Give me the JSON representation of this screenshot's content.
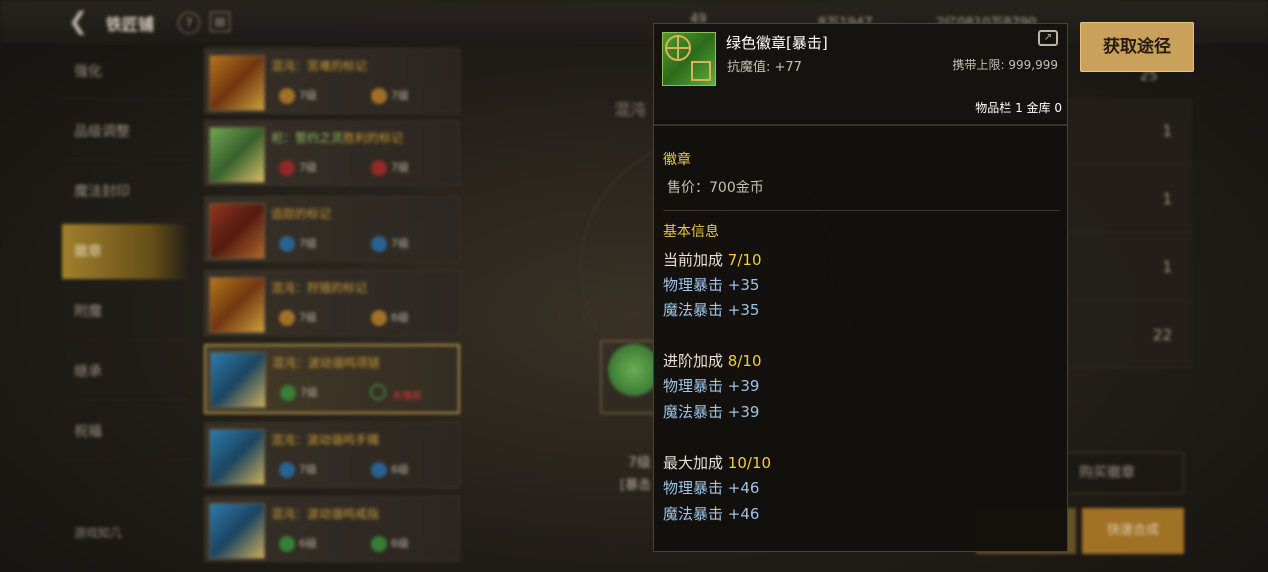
{
  "header": {
    "title": "铁匠铺",
    "help_label": "?",
    "res1": "49",
    "res2": "8万1947",
    "res3": "2亿0810万8790"
  },
  "nav": {
    "items": [
      "强化",
      "品级调整",
      "魔法封印",
      "徽章",
      "附魔",
      "继承",
      "祝福"
    ],
    "active": "徽章"
  },
  "list": [
    {
      "name": "混沌：苦难的标记",
      "lv1": "7级",
      "lv2": "7级",
      "color": "red"
    },
    {
      "name_a": "祀：誓约之灵",
      "name_b": "胜利的标记",
      "lv1": "7级",
      "lv2": "7级",
      "color": "green"
    },
    {
      "name": "追踪的标记",
      "lv1": "7级",
      "lv2": "7级",
      "color": "red"
    },
    {
      "name": "混沌：狩猎的标记",
      "lv1": "7级",
      "lv2": "6级",
      "color": "red"
    },
    {
      "name": "混沌：波动谐鸣项链",
      "lv1": "7级",
      "warn": "未镶嵌",
      "color": "blue",
      "selected": true
    },
    {
      "name": "混沌：波动谐鸣手镯",
      "lv1": "7级",
      "lv2": "6级",
      "color": "blue"
    },
    {
      "name": "混沌：波动谐鸣戒指",
      "lv1": "6级",
      "lv2": "6级",
      "color": "blue"
    }
  ],
  "center": {
    "title": "混沌",
    "level": "7级",
    "sub": "[暴击"
  },
  "right": {
    "counter": "25",
    "rows": [
      "1",
      "1",
      "1",
      "22"
    ],
    "buy_label": "购买徽章",
    "quick_label": "快速合成"
  },
  "footer": {
    "logo_text": "游戏知几"
  },
  "tooltip": {
    "name": "绿色徽章[暴击]",
    "resist": "抗魔值: +77",
    "limit": "携带上限: 999,999",
    "inventory": "物品栏 1 金库 0",
    "category": "徽章",
    "price": "售价：700金币",
    "basic_info": "基本信息",
    "current_label": "当前加成",
    "current_value": "7/10",
    "current_stats": [
      "物理暴击 +35",
      "魔法暴击 +35"
    ],
    "advanced_label": "进阶加成",
    "advanced_value": "8/10",
    "advanced_stats": [
      "物理暴击 +39",
      "魔法暴击 +39"
    ],
    "max_label": "最大加成",
    "max_value": "10/10",
    "max_stats": [
      "物理暴击 +46",
      "魔法暴击 +46"
    ]
  },
  "get_source_button": "获取途径",
  "colors": {
    "gold": "#e8c64a",
    "value": "#f2cf3a",
    "stat": "#9ec4e8",
    "button": "#c9a15a"
  }
}
